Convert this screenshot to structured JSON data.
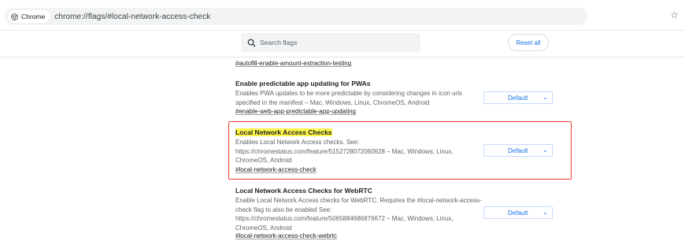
{
  "omnibox": {
    "chip_label": "Chrome",
    "url": "chrome://flags/#local-network-access-check",
    "star_icon": "bookmark-star-icon"
  },
  "search": {
    "placeholder": "Search flags"
  },
  "reset_label": "Reset all",
  "flags": [
    {
      "link": "#autofill-enable-amount-extraction-testing"
    },
    {
      "title": "Enable predictable app updating for PWAs",
      "desc": [
        "Enables PWA updates to be more predictable by considering changes in icon urls",
        "specified in the manifest – Mac, Windows, Linux, ChromeOS, Android"
      ],
      "link": "#enable-web-app-predictable-app-updating",
      "select": "Default"
    },
    {
      "title": "Local Network Access Checks",
      "desc": [
        "Enables Local Network Access checks. See:",
        "https://chromestatus.com/feature/5152728072060928 – Mac, Windows, Linux,",
        "ChromeOS, Android"
      ],
      "link": "#local-network-access-check",
      "select": "Default"
    },
    {
      "title": "Local Network Access Checks for WebRTC",
      "desc": [
        "Enable Local Network Access checks for WebRTC. Requires the #local-network-access-",
        "check flag to also be enabled See:",
        "https://chromestatus.com/feature/5065884686876672 – Mac, Windows, Linux,",
        "ChromeOS, Android"
      ],
      "link": "#local-network-access-check-webrtc",
      "select": "Default"
    }
  ]
}
